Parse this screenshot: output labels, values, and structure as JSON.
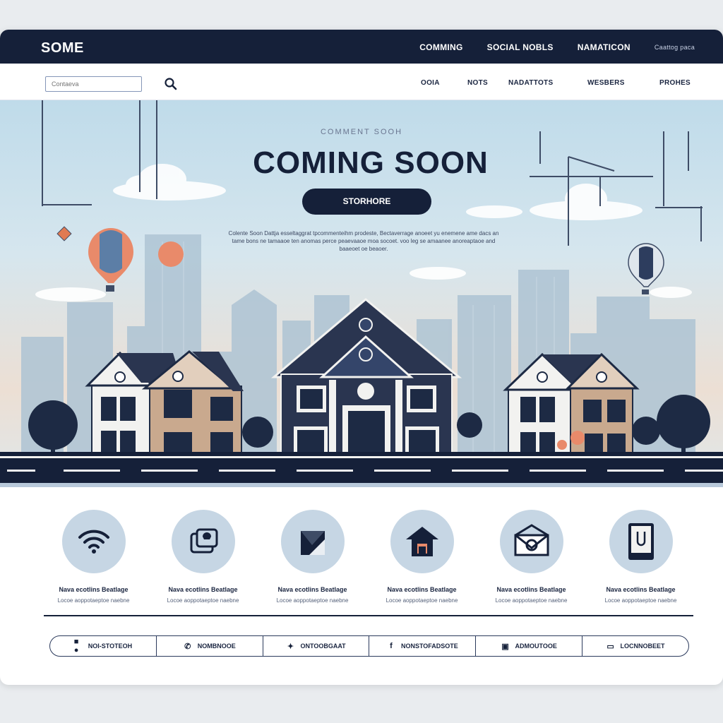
{
  "header": {
    "logo": "SOME",
    "nav": [
      "COMMING",
      "SOCIAL NOBLS",
      "NAMATICON"
    ],
    "nav_small": "Caattog paca"
  },
  "subheader": {
    "search_placeholder": "Contaeva",
    "nav": [
      "OOIA",
      "NOTS",
      "NADATTOTS",
      "WESBERS",
      "PROHES"
    ]
  },
  "hero": {
    "eyebrow": "COMMENT SOOH",
    "title": "COMING SOON",
    "cta_label": "STORHORE",
    "description": "Colente Soon Dattja esseltaggrat tpcommenteihm prodeste, Bectaverrage anoeet yu enemene ame dacs an tame bons ne tamaaoe ten anomas perce peaevaaoe moa socoet. voo leg se amaanee anoreaptaoe and baaeoet oe beaoer."
  },
  "features": [
    {
      "icon": "wifi-icon",
      "title": "Nava ecotlins Beatlage",
      "text": "Locoe aoppotaeptoe naebne"
    },
    {
      "icon": "chat-bubble-icon",
      "title": "Nava ecotlins Beatlage",
      "text": "Locoe aoppotaeptoe naebne"
    },
    {
      "icon": "package-icon",
      "title": "Nava ecotlins Beatlage",
      "text": "Locoe aoppotaeptoe naebne"
    },
    {
      "icon": "home-icon",
      "title": "Nava ecotlins Beatlage",
      "text": "Locoe aoppotaeptoe naebne"
    },
    {
      "icon": "envelope-icon",
      "title": "Nava ecotlins Beatlage",
      "text": "Locoe aoppotaeptoe naebne"
    },
    {
      "icon": "device-icon",
      "title": "Nava ecotlins Beatlage",
      "text": "Locoe aoppotaeptoe naebne"
    }
  ],
  "contacts": [
    {
      "icon": "info-icon",
      "label": "NOI-STOTEOH"
    },
    {
      "icon": "phone-icon",
      "label": "NOMBNOOE"
    },
    {
      "icon": "twitter-icon",
      "label": "ONTOOBGAAT"
    },
    {
      "icon": "facebook-icon",
      "label": "NONSTOFADSOTE"
    },
    {
      "icon": "instagram-icon",
      "label": "ADMOUTOOE"
    },
    {
      "icon": "location-icon",
      "label": "LOCNNOBEET"
    }
  ],
  "colors": {
    "navy": "#152039",
    "icon_circle": "#c6d6e4",
    "sky": "#bfdbea"
  }
}
